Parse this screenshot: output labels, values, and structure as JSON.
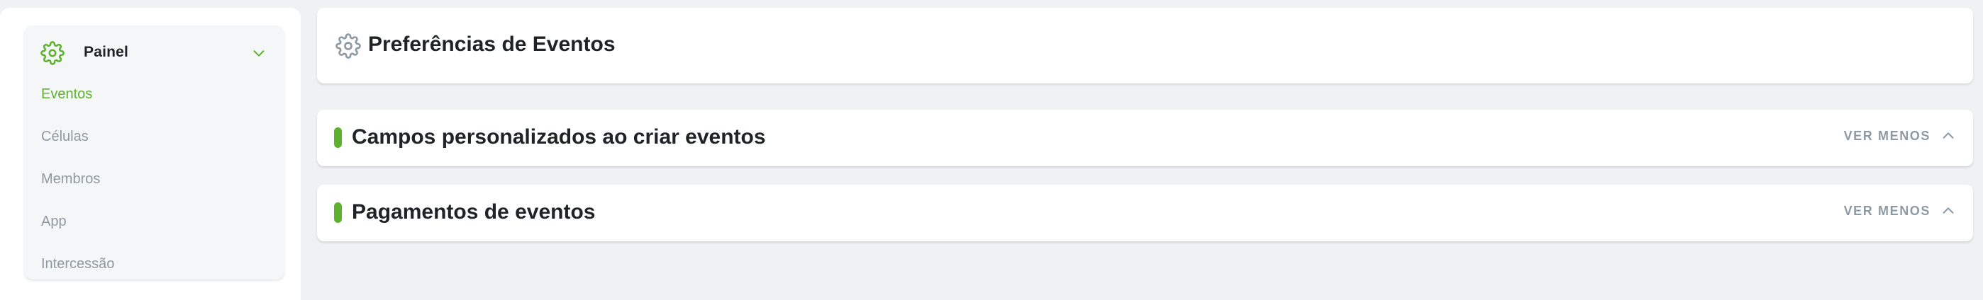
{
  "colors": {
    "accent": "#5db12c",
    "text_dark": "#1f2328",
    "text_muted": "#8e9aa3",
    "background": "#f0f1f5",
    "card": "#ffffff"
  },
  "sidebar": {
    "header": {
      "icon": "gear-icon",
      "label": "Painel",
      "expand_icon": "chevron-down-icon"
    },
    "items": [
      {
        "label": "Eventos",
        "active": true
      },
      {
        "label": "Células",
        "active": false
      },
      {
        "label": "Membros",
        "active": false
      },
      {
        "label": "App",
        "active": false
      },
      {
        "label": "Intercessão",
        "active": false
      }
    ]
  },
  "main": {
    "page_header": {
      "icon": "gear-icon",
      "title": "Preferências de Eventos"
    },
    "sections": [
      {
        "title": "Campos personalizados ao criar eventos",
        "toggle_label": "VER MENOS",
        "toggle_icon": "chevron-up-icon"
      },
      {
        "title": "Pagamentos de eventos",
        "toggle_label": "VER MENOS",
        "toggle_icon": "chevron-up-icon"
      }
    ]
  }
}
